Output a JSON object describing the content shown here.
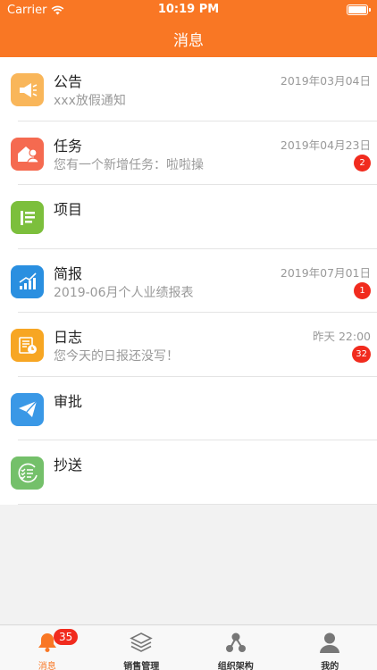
{
  "status_bar": {
    "carrier": "Carrier",
    "time": "10:19 PM"
  },
  "header": {
    "title": "消息"
  },
  "items": [
    {
      "icon": "announcement-icon",
      "color": "#f9b65a",
      "title": "公告",
      "subtitle": "xxx放假通知",
      "date": "2019年03月04日",
      "badge": ""
    },
    {
      "icon": "task-icon",
      "color": "#f56a50",
      "title": "任务",
      "subtitle": "您有一个新增任务：啦啦操",
      "date": "2019年04月23日",
      "badge": "2"
    },
    {
      "icon": "project-icon",
      "color": "#7cbf3c",
      "title": "项目",
      "subtitle": "",
      "date": "",
      "badge": ""
    },
    {
      "icon": "report-chart-icon",
      "color": "#2a8fe0",
      "title": "简报",
      "subtitle": "2019-06月个人业绩报表",
      "date": "2019年07月01日",
      "badge": "1"
    },
    {
      "icon": "log-icon",
      "color": "#f7a623",
      "title": "日志",
      "subtitle": "您今天的日报还没写！",
      "date": "昨天  22:00",
      "badge": "32"
    },
    {
      "icon": "approval-send-icon",
      "color": "#3a98e6",
      "title": "审批",
      "subtitle": "",
      "date": "",
      "badge": ""
    },
    {
      "icon": "cc-checklist-icon",
      "color": "#74c06a",
      "title": "抄送",
      "subtitle": "",
      "date": "",
      "badge": ""
    }
  ],
  "tabs": [
    {
      "label": "消息",
      "icon": "bell-icon",
      "badge": "35",
      "active": true
    },
    {
      "label": "销售管理",
      "icon": "layers-icon",
      "badge": "",
      "active": false
    },
    {
      "label": "组织架构",
      "icon": "org-nodes-icon",
      "badge": "",
      "active": false
    },
    {
      "label": "我的",
      "icon": "person-icon",
      "badge": "",
      "active": false
    }
  ],
  "colors": {
    "brand": "#f97724",
    "badge": "#f12b1e"
  }
}
